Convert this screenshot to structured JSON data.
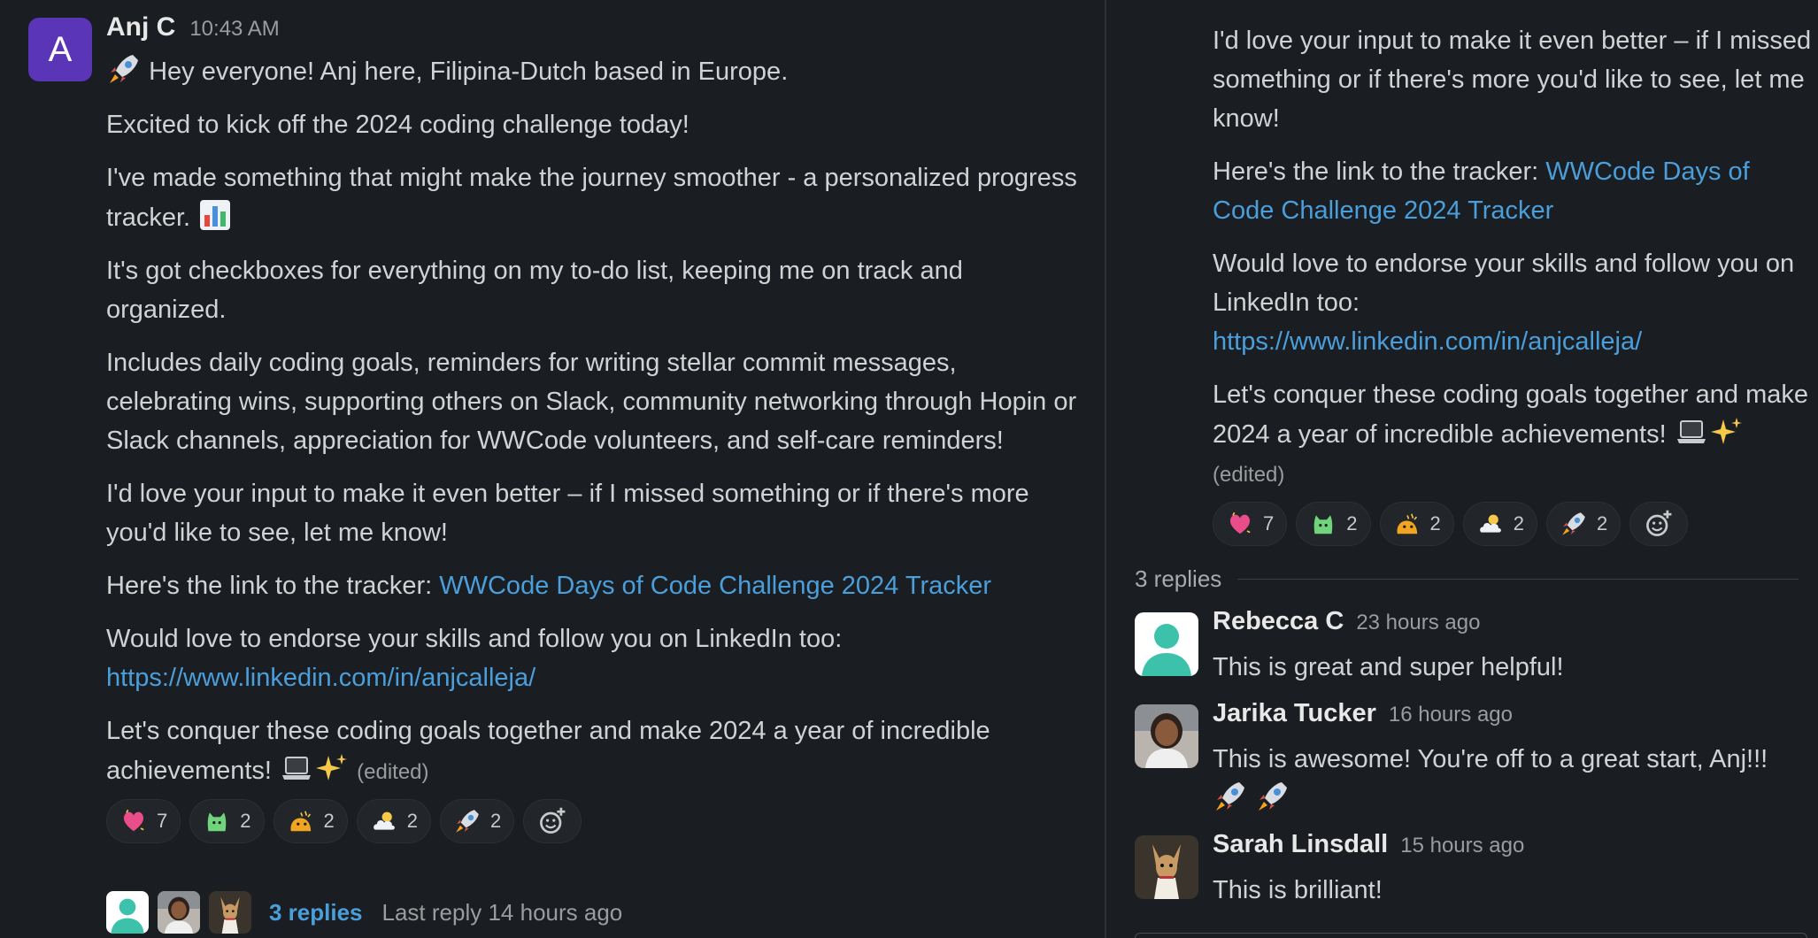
{
  "message": {
    "avatar_letter": "A",
    "author": "Anj C",
    "time": "10:43 AM",
    "lines": {
      "intro": "Hey everyone! Anj here, Filipina-Dutch based in Europe.",
      "excited": "Excited to kick off the 2024 coding challenge today!",
      "made": "I've made something that might make the journey smoother - a personalized progress tracker.",
      "checkboxes": "It's got checkboxes for everything on my to-do list, keeping me on track and organized.",
      "includes": "Includes daily coding goals, reminders for writing stellar commit messages, celebrating wins, supporting others on Slack, community networking through Hopin or Slack channels, appreciation for WWCode volunteers, and self-care reminders!",
      "input": "I'd love your input to make it even better – if I missed something or if there's more you'd like to see, let me know!",
      "tracker_prefix": "Here's the link to the tracker: ",
      "tracker_link": "WWCode Days of Code Challenge 2024 Tracker",
      "endorse": "Would love to endorse your skills and follow you on LinkedIn too:",
      "linkedin_url": "https://www.linkedin.com/in/anjcalleja/",
      "conquer": "Let's conquer these coding goals together and make 2024 a year of incredible achievements!",
      "edited": "(edited)"
    },
    "reactions": [
      {
        "icon": "sparkling-heart-icon",
        "count": "7"
      },
      {
        "icon": "green-cat-icon",
        "count": "2"
      },
      {
        "icon": "party-blob-icon",
        "count": "2"
      },
      {
        "icon": "sun-cloud-icon",
        "count": "2"
      },
      {
        "icon": "rocket-icon",
        "count": "2"
      }
    ],
    "thread": {
      "replies_label": "3 replies",
      "last_reply": "Last reply 14 hours ago"
    }
  },
  "thread_panel": {
    "replies_count": "3 replies",
    "replies": [
      {
        "name": "Rebecca C",
        "time": "23 hours ago",
        "text": "This is great and super helpful!"
      },
      {
        "name": "Jarika Tucker",
        "time": "16 hours ago",
        "text": "This is awesome! You're off to a great start, Anj!!!"
      },
      {
        "name": "Sarah Linsdall",
        "time": "15 hours ago",
        "text": "This is brilliant!"
      }
    ]
  },
  "colors": {
    "background": "#1a1d21",
    "link": "#4a9fdb",
    "avatar": "#5b35b8"
  }
}
